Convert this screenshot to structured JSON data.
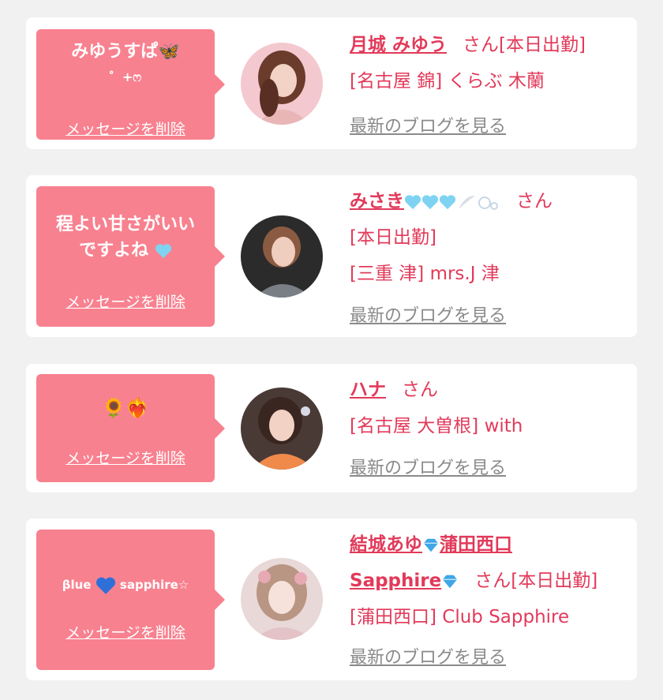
{
  "colors": {
    "background": "#f1f1f1",
    "card": "#ffffff",
    "bubble": "#f8818f",
    "accent": "#e23a5a",
    "link_gray": "#8a8a8a"
  },
  "cards": [
    {
      "message": "みゆうすぱ🦋",
      "message_line2": "゜+ෆ",
      "delete_label": "メッセージを削除",
      "name": "月城 みゆう",
      "honorific": "さん",
      "status": "[本日出勤]",
      "shop": "[名古屋 錦] くらぶ 木蘭",
      "blog_label": "最新のブログを見る"
    },
    {
      "message": "程よい甘さがいい",
      "message_line2": "ですよね",
      "delete_label": "メッセージを削除",
      "name": "みさき",
      "honorific": "さん",
      "status": "[本日出勤]",
      "shop": "[三重 津] mrs.J 津",
      "blog_label": "最新のブログを見る"
    },
    {
      "message": "🌻❤️‍🔥",
      "delete_label": "メッセージを削除",
      "name": "ハナ",
      "honorific": "さん",
      "shop": "[名古屋 大曽根] with",
      "blog_label": "最新のブログを見る"
    },
    {
      "message_a": "βlue",
      "message_b": "sapphire☆",
      "delete_label": "メッセージを削除",
      "name_line1": "結城あゆ",
      "name_line1b": "蒲田西口",
      "name_line2": "Sapphire",
      "honorific": "さん",
      "status": "[本日出勤]",
      "shop": "[蒲田西口] Club Sapphire",
      "blog_label": "最新のブログを見る"
    }
  ]
}
